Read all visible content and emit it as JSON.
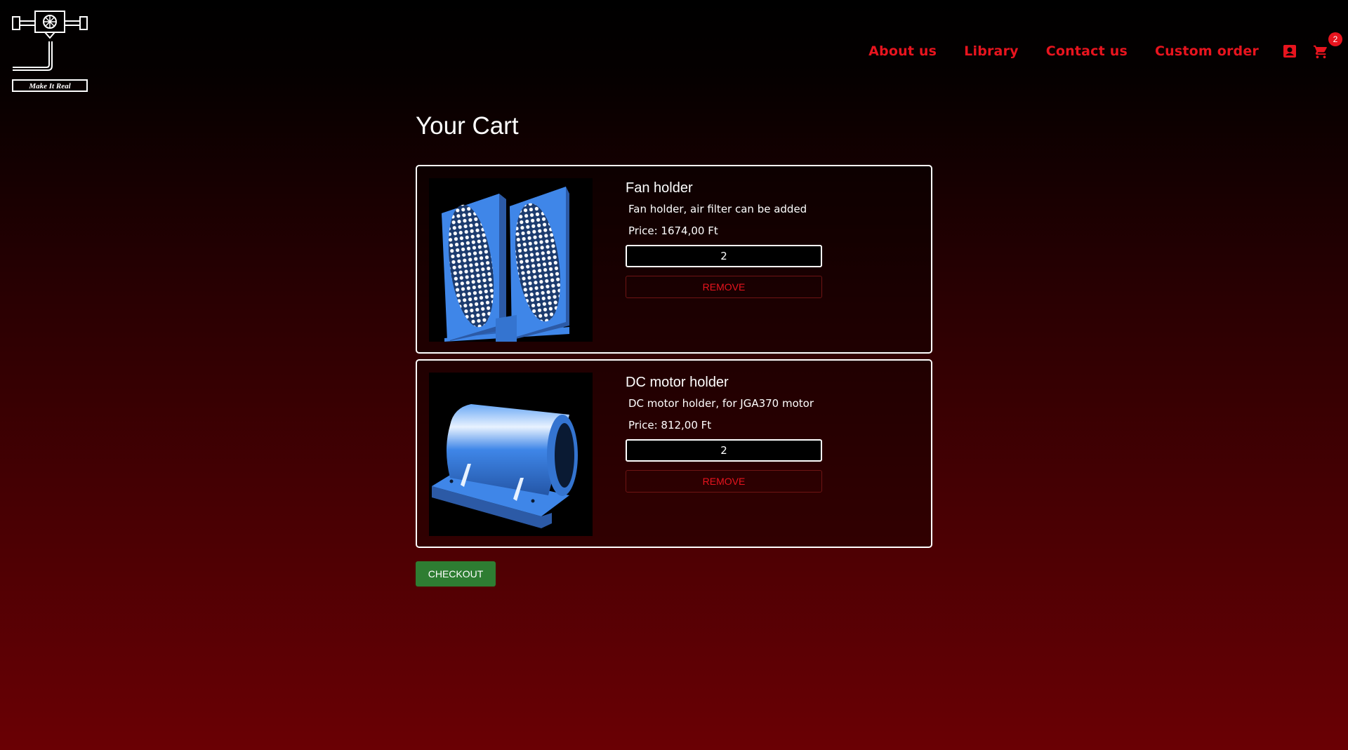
{
  "brand": {
    "logo_text": "Make It Real"
  },
  "nav": {
    "links": [
      {
        "label": "About us"
      },
      {
        "label": "Library"
      },
      {
        "label": "Contact us"
      },
      {
        "label": "Custom order"
      }
    ],
    "user_icon": "user-account-icon",
    "cart_icon": "shopping-cart-icon",
    "cart_count": "2"
  },
  "colors": {
    "accent": "#e8141e",
    "checkout": "#2e7d32",
    "product_model": "#3f86e8",
    "background_top": "#000000",
    "background_bottom": "#6a0004"
  },
  "page": {
    "title": "Your Cart"
  },
  "cart": {
    "items": [
      {
        "name": "Fan holder",
        "description": "Fan holder, air filter can be added",
        "price": "Price: 1674,00 Ft",
        "quantity": "2",
        "remove_label": "REMOVE"
      },
      {
        "name": "DC motor holder",
        "description": "DC motor holder, for JGA370 motor",
        "price": "Price: 812,00 Ft",
        "quantity": "2",
        "remove_label": "REMOVE"
      }
    ],
    "checkout_label": "CHECKOUT"
  }
}
